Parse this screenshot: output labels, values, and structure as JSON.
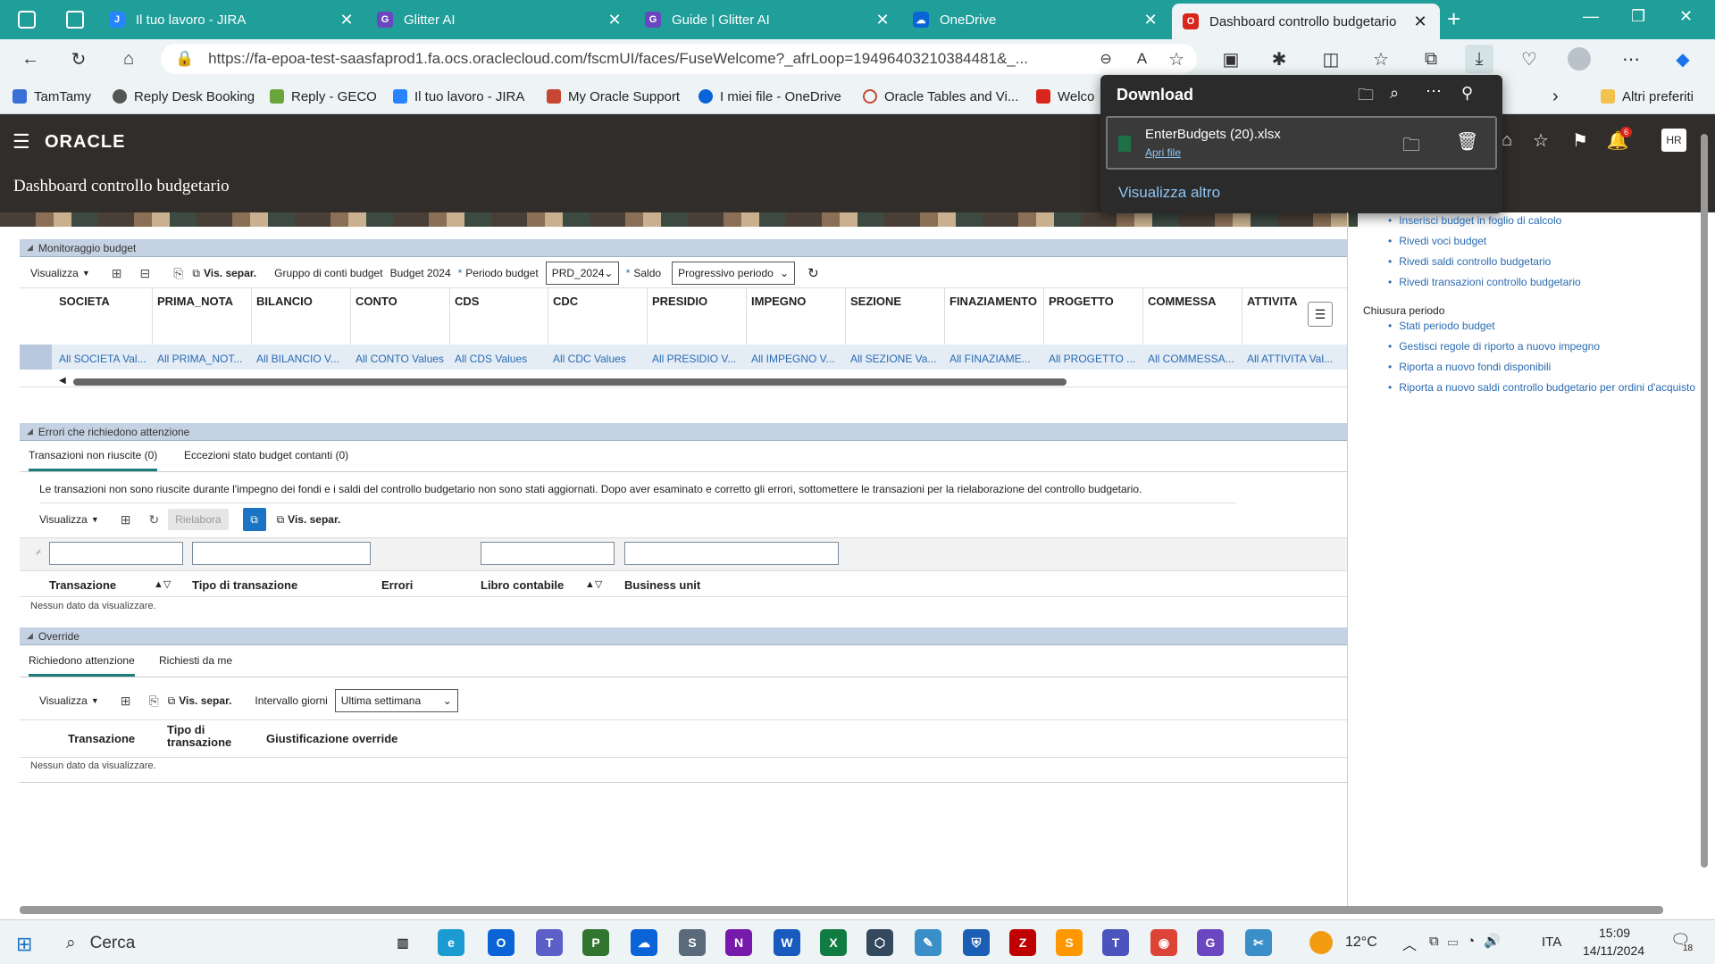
{
  "browser": {
    "tabs": [
      {
        "label": "Il tuo lavoro - JIRA",
        "icon": "jira-icon"
      },
      {
        "label": "Glitter AI",
        "icon": "glitter-icon"
      },
      {
        "label": "Guide | Glitter AI",
        "icon": "glitter-icon"
      },
      {
        "label": "OneDrive",
        "icon": "onedrive-icon"
      },
      {
        "label": "Dashboard controllo budgetario",
        "icon": "oracle-icon"
      }
    ],
    "url": "https://fa-epoa-test-saasfaprod1.fa.ocs.oraclecloud.com/fscmUI/faces/FuseWelcome?_afrLoop=19496403210384481&_...",
    "bookmarks": [
      {
        "label": "TamTamy",
        "color": "#3a6fd8"
      },
      {
        "label": "Reply Desk Booking",
        "color": "#555555"
      },
      {
        "label": "Reply - GECO",
        "color": "#6aa53a"
      },
      {
        "label": "Il tuo lavoro - JIRA",
        "color": "#2684ff"
      },
      {
        "label": "My Oracle Support",
        "color": "#c74634"
      },
      {
        "label": "I miei file - OneDrive",
        "color": "#0a64d8"
      },
      {
        "label": "Oracle Tables and Vi...",
        "color": "#c74634"
      },
      {
        "label": "Welco",
        "color": "#d9261c"
      }
    ],
    "other_favorites": "Altri preferiti"
  },
  "download": {
    "title": "Download",
    "file": "EnterBudgets (20).xlsx",
    "open": "Apri file",
    "more": "Visualizza altro"
  },
  "oracle": {
    "logo": "ORACLE",
    "page_title": "Dashboard controllo budgetario",
    "notif_count": "6",
    "user_initials": "HR"
  },
  "monitor": {
    "title": "Monitoraggio budget",
    "view": "Visualizza",
    "detach": "Vis. separ.",
    "group_label": "Gruppo di conti budget",
    "group_value": "Budget 2024",
    "period_label": "Periodo budget",
    "period_value": "PRD_2024",
    "balance_label": "Saldo",
    "balance_value": "Progressivo periodo",
    "columns": [
      {
        "h": "SOCIETA",
        "v": "All SOCIETA Val..."
      },
      {
        "h": "PRIMA_NOTA",
        "v": "All PRIMA_NOT..."
      },
      {
        "h": "BILANCIO",
        "v": "All BILANCIO V..."
      },
      {
        "h": "CONTO",
        "v": "All CONTO Values"
      },
      {
        "h": "CDS",
        "v": "All CDS Values"
      },
      {
        "h": "CDC",
        "v": "All CDC Values"
      },
      {
        "h": "PRESIDIO",
        "v": "All PRESIDIO V..."
      },
      {
        "h": "IMPEGNO",
        "v": "All IMPEGNO V..."
      },
      {
        "h": "SEZIONE",
        "v": "All SEZIONE Va..."
      },
      {
        "h": "FINAZIAMENTO",
        "v": "All FINAZIAME..."
      },
      {
        "h": "PROGETTO",
        "v": "All PROGETTO ..."
      },
      {
        "h": "COMMESSA",
        "v": "All COMMESSA..."
      },
      {
        "h": "ATTIVITA",
        "v": "All ATTIVITA Val..."
      }
    ]
  },
  "errors": {
    "title": "Errori che richiedono attenzione",
    "tab1": "Transazioni non riuscite (0)",
    "tab2": "Eccezioni stato budget contanti (0)",
    "message": "Le transazioni non sono riuscite durante l'impegno dei fondi e i saldi del controllo budgetario non sono stati aggiornati. Dopo aver esaminato e corretto gli errori, sottomettere le transazioni per la rielaborazione del controllo budgetario.",
    "view": "Visualizza",
    "reprocess": "Rielabora",
    "detach": "Vis. separ.",
    "col_transaction": "Transazione",
    "col_type": "Tipo di transazione",
    "col_errors": "Errori",
    "col_ledger": "Libro contabile",
    "col_bu": "Business unit",
    "empty": "Nessun dato da visualizzare."
  },
  "override": {
    "title": "Override",
    "tab1": "Richiedono attenzione",
    "tab2": "Richiesti da me",
    "view": "Visualizza",
    "detach": "Vis. separ.",
    "interval_label": "Intervallo giorni",
    "interval_value": "Ultima settimana",
    "col_transaction": "Transazione",
    "col_type": "Tipo di transazione",
    "col_just": "Giustificazione override",
    "empty": "Nessun dato da visualizzare."
  },
  "tasks": {
    "links1": [
      "Inserisci budget in foglio di calcolo",
      "Rivedi voci budget",
      "Rivedi saldi controllo budgetario",
      "Rivedi transazioni controllo budgetario"
    ],
    "section2": "Chiusura periodo",
    "links2": [
      "Stati periodo budget",
      "Gestisci regole di riporto a nuovo impegno",
      "Riporta a nuovo fondi disponibili",
      "Riporta a nuovo saldi controllo budgetario per ordini d'acquisto"
    ]
  },
  "taskbar": {
    "search": "Cerca",
    "temp": "12°C",
    "lang": "ITA",
    "time": "15:09",
    "date": "14/11/2024",
    "notif": "18"
  }
}
